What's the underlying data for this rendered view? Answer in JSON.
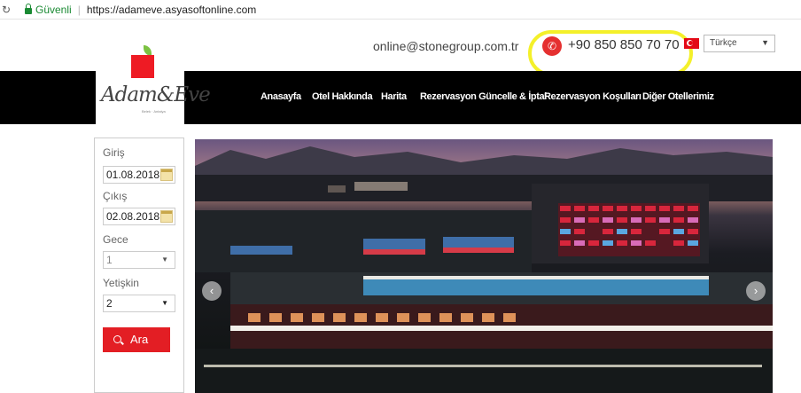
{
  "browser": {
    "secure_label": "Güvenli",
    "url": "https://adameve.asyasoftonline.com"
  },
  "header": {
    "email": "online@stonegroup.com.tr",
    "phone": "+90 850 850 70 70",
    "language": "Türkçe"
  },
  "logo": {
    "text": "Adam&Eve",
    "subtext": "Belek · Antalya"
  },
  "nav": {
    "items": [
      "Anasayfa",
      "Otel Hakkında",
      "Harita",
      "Rezervasyon Güncelle & İptal",
      "Rezervasyon Koşulları",
      "Diğer Otellerimiz"
    ]
  },
  "booking": {
    "checkin_label": "Giriş",
    "checkin_value": "01.08.2018",
    "checkout_label": "Çıkış",
    "checkout_value": "02.08.2018",
    "nights_label": "Gece",
    "nights_value": "1",
    "adults_label": "Yetişkin",
    "adults_value": "2",
    "search_label": "Ara"
  },
  "colors": {
    "brand_red": "#e31e24",
    "nav_bg": "#000000",
    "highlight": "#f4f02a"
  }
}
